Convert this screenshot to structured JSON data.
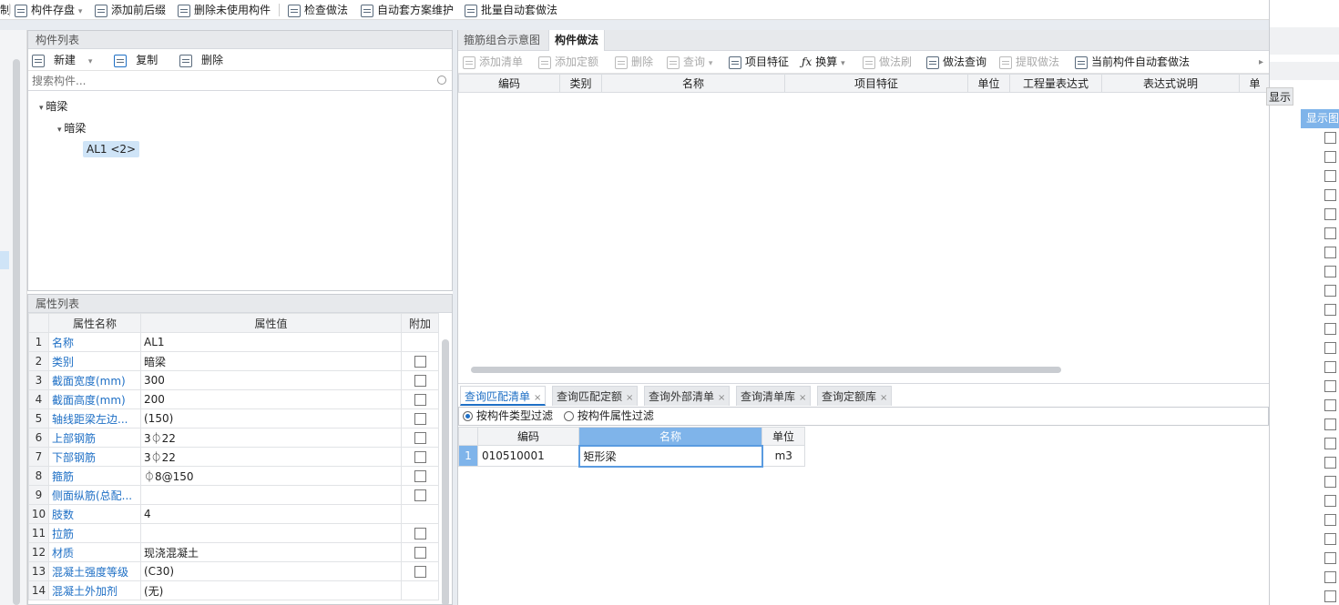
{
  "toolbar": {
    "partial": "制",
    "save_comp": "构件存盘",
    "add_prefix": "添加前后缀",
    "delete_unused": "删除未使用构件",
    "check_method": "检查做法",
    "auto_plan": "自动套方案维护",
    "batch_auto": "批量自动套做法"
  },
  "component_list": {
    "title": "构件列表",
    "new_label": "新建",
    "copy_label": "复制",
    "delete_label": "删除",
    "search_placeholder": "搜索构件...",
    "tree": {
      "root": "暗梁",
      "child": "暗梁",
      "leaf": "AL1 <2>"
    }
  },
  "property_list": {
    "title": "属性列表",
    "headers": [
      "属性名称",
      "属性值",
      "附加"
    ],
    "rows": [
      {
        "num": "1",
        "name": "名称",
        "value": "AL1"
      },
      {
        "num": "2",
        "name": "类别",
        "value": "暗梁"
      },
      {
        "num": "3",
        "name": "截面宽度(mm)",
        "value": "300"
      },
      {
        "num": "4",
        "name": "截面高度(mm)",
        "value": "200"
      },
      {
        "num": "5",
        "name": "轴线距梁左边...",
        "value": "(150)"
      },
      {
        "num": "6",
        "name": "上部钢筋",
        "value": "3⏀22"
      },
      {
        "num": "7",
        "name": "下部钢筋",
        "value": "3⏀22"
      },
      {
        "num": "8",
        "name": "箍筋",
        "value": "⏀8@150"
      },
      {
        "num": "9",
        "name": "侧面纵筋(总配...",
        "value": ""
      },
      {
        "num": "10",
        "name": "肢数",
        "value": "4"
      },
      {
        "num": "11",
        "name": "拉筋",
        "value": ""
      },
      {
        "num": "12",
        "name": "材质",
        "value": "现浇混凝土"
      },
      {
        "num": "13",
        "name": "混凝土强度等级",
        "value": "(C30)"
      },
      {
        "num": "14",
        "name": "混凝土外加剂",
        "value": "(无)"
      }
    ]
  },
  "right_tabs": {
    "tab1": "箍筋组合示意图",
    "tab2": "构件做法"
  },
  "method_toolbar": {
    "add_list": "添加清单",
    "add_quota": "添加定额",
    "delete": "删除",
    "query": "查询",
    "item_feature": "项目特征",
    "convert": "换算",
    "method_brush": "做法刷",
    "method_query": "做法查询",
    "extract_method": "提取做法",
    "auto_current": "当前构件自动套做法"
  },
  "method_table": {
    "headers": [
      "编码",
      "类别",
      "名称",
      "项目特征",
      "单位",
      "工程量表达式",
      "表达式说明",
      "单"
    ]
  },
  "query_tabs": [
    "查询匹配清单",
    "查询匹配定额",
    "查询外部清单",
    "查询清单库",
    "查询定额库"
  ],
  "filter": {
    "by_type": "按构件类型过滤",
    "by_attr": "按构件属性过滤"
  },
  "query_table": {
    "headers": [
      "编码",
      "名称",
      "单位"
    ],
    "rows": [
      {
        "num": "1",
        "code": "010510001",
        "name": "矩形梁",
        "unit": "m3"
      }
    ]
  },
  "far_right": {
    "show_btn": "显示",
    "col_header": "显示图"
  },
  "colors": {
    "accent": "#1e6fc5",
    "header_bg": "#e7e9ec",
    "selection": "#cfe4f7"
  }
}
